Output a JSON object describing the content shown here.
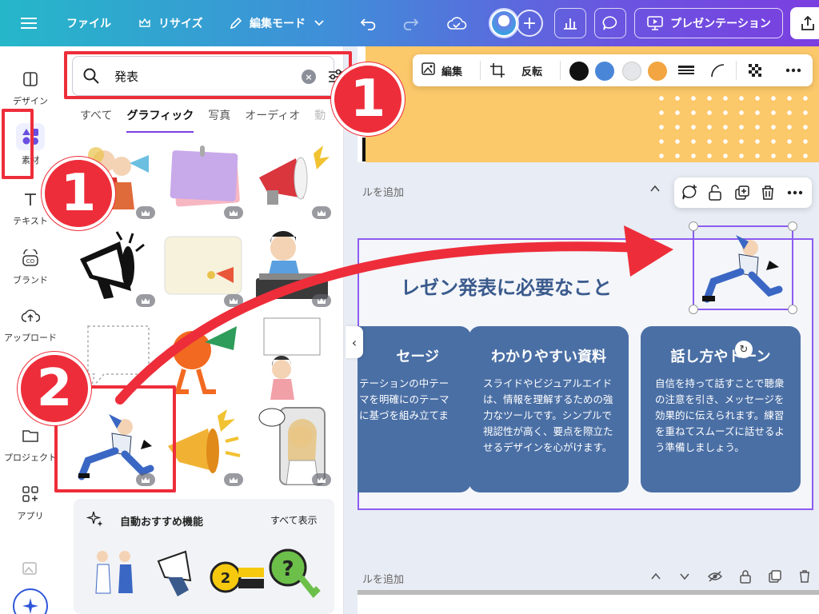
{
  "topbar": {
    "file_label": "ファイル",
    "resize_label": "リサイズ",
    "editmode_label": "編集モード",
    "present_label": "プレゼンテーション"
  },
  "leftnav": {
    "items": [
      {
        "label": "デザイン"
      },
      {
        "label": "素材"
      },
      {
        "label": "テキスト"
      },
      {
        "label": "ブランド"
      },
      {
        "label": "アップロード"
      },
      {
        "label": "プロジェクト"
      },
      {
        "label": "アプリ"
      }
    ]
  },
  "panel": {
    "search_value": "発表",
    "tabs": [
      {
        "label": "すべて"
      },
      {
        "label": "グラフィック"
      },
      {
        "label": "写真"
      },
      {
        "label": "オーディオ"
      },
      {
        "label": "動"
      }
    ],
    "suggest_title": "自動おすすめ機能",
    "suggest_all": "すべて表示"
  },
  "canvas": {
    "float_toolbar": {
      "edit_label": "編集",
      "flip_label": "反転",
      "colors": [
        "#111111",
        "#4a86d8",
        "#e4e6ea",
        "#f2a541"
      ]
    },
    "page_label": "ルを追加",
    "slide": {
      "title": "レゼン発表に必要なこと",
      "cards": [
        {
          "title": "セージ",
          "body": "テーションの中テーマを明確にのテーマに基づを組み立てま"
        },
        {
          "title": "わかりやすい資料",
          "body": "スライドやビジュアルエイドは、情報を理解するための強力なツールです。シンプルで視認性が高く、要点を際立たせるデザインを心がけます。"
        },
        {
          "title": "話し方やトーン",
          "body": "自信を持って話すことで聴衆の注意を引き、メッセージを効果的に伝えられます。練習を重ねてスムーズに話せるよう準備しましょう。"
        }
      ]
    }
  },
  "annotations": {
    "badge_1": "1",
    "badge_2": "2",
    "accent": "#ee2d3a"
  }
}
